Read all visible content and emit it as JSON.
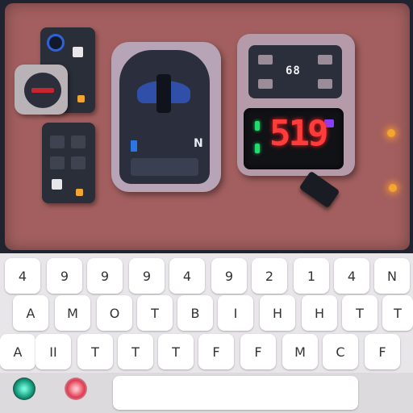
{
  "device": {
    "gear_indicator": "N",
    "top_display": "68",
    "main_readout": "519",
    "colors": {
      "panel": "#a35f5f",
      "readout": "#ff3c3c",
      "accent_blue": "#2f62d8",
      "status_green": "#1fdc6b",
      "indicator_orange": "#f2a531"
    }
  },
  "keyboard": {
    "row1": [
      "4",
      "9",
      "9",
      "9",
      "4",
      "9",
      "2",
      "1",
      "4",
      "N"
    ],
    "row2": [
      "A",
      "M",
      "O",
      "T",
      "B",
      "I",
      "H",
      "H",
      "T",
      "T"
    ],
    "row3": [
      "A",
      "II",
      "T",
      "T",
      "T",
      "F",
      "F",
      "M",
      "C",
      "F"
    ]
  },
  "status_lights": {
    "left_color": "#0a8c6e",
    "right_color": "#e03a4f"
  }
}
